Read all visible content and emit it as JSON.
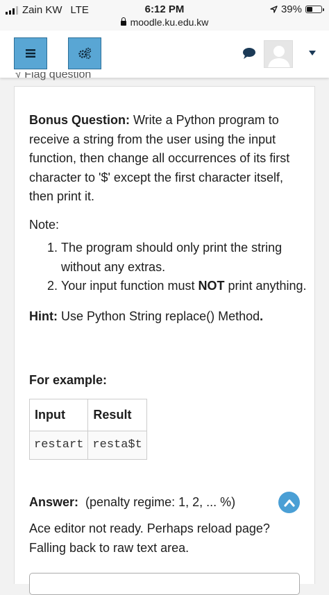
{
  "status": {
    "carrier": "Zain KW",
    "network": "LTE",
    "time": "6:12 PM",
    "url": "moodle.ku.edu.kw",
    "battery": "39%",
    "battery_level": 0.39
  },
  "nav": {
    "flag_label": "Flag question"
  },
  "question": {
    "bonus_label": "Bonus Question:",
    "bonus_text": " Write a Python program to receive a string from the user using the input function, then change all occurrences of its first character to '$' except the first character itself, then print it.",
    "note_label": "Note:",
    "items": [
      "The program should only print the string without any extras.",
      {
        "before": "Your input function must ",
        "bold": "NOT",
        "after": " print anything."
      }
    ],
    "hint_label": "Hint:",
    "hint_text": " Use Python String replace() Method",
    "hint_end": ".",
    "example_label": "For example:",
    "table": {
      "headers": [
        "Input",
        "Result"
      ],
      "rows": [
        [
          "restart",
          "resta$t"
        ]
      ]
    },
    "answer_label": "Answer:",
    "answer_regime": "(penalty regime: 1, 2, ... %)",
    "ace_text": "Ace editor not ready. Perhaps reload page? Falling back to raw text area."
  },
  "colors": {
    "accent": "#59a6d4",
    "dark_blue": "#1b3a57",
    "scroll_button": "#4a9fd5"
  }
}
